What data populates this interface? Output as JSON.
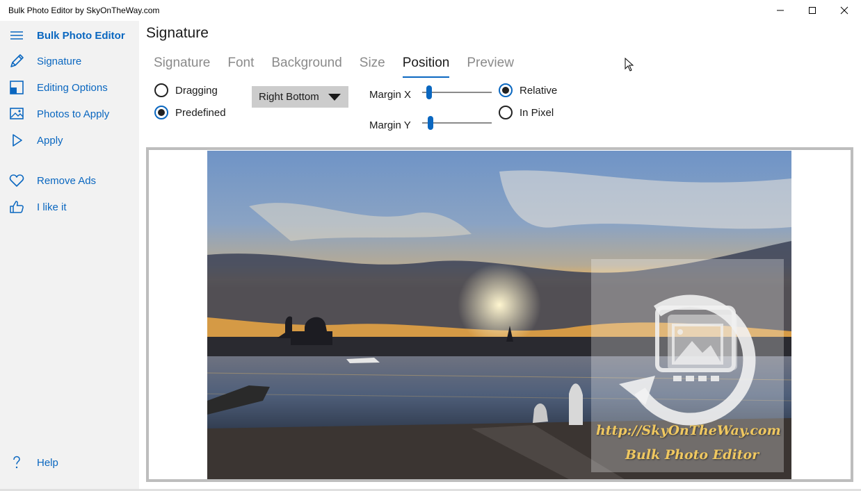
{
  "window": {
    "title": "Bulk Photo Editor by SkyOnTheWay.com",
    "controls": [
      "minimize-icon",
      "maximize-icon",
      "close-icon"
    ]
  },
  "sidebar": {
    "app_title": "Bulk Photo Editor",
    "items": [
      {
        "label": "Signature",
        "icon": "pencil-icon"
      },
      {
        "label": "Editing Options",
        "icon": "editing-options-icon"
      },
      {
        "label": "Photos to Apply",
        "icon": "image-icon"
      },
      {
        "label": "Apply",
        "icon": "play-icon"
      },
      {
        "label": "Remove Ads",
        "icon": "heart-icon"
      },
      {
        "label": "I like it",
        "icon": "thumbs-up-icon"
      },
      {
        "label": "Help",
        "icon": "question-icon"
      }
    ]
  },
  "main": {
    "title": "Signature",
    "tabs": [
      "Signature",
      "Font",
      "Background",
      "Size",
      "Position",
      "Preview"
    ],
    "active_tab": "Position",
    "position": {
      "mode_options": [
        {
          "label": "Dragging",
          "checked": false
        },
        {
          "label": "Predefined",
          "checked": true
        }
      ],
      "predefined_value": "Right Bottom",
      "margin_x_label": "Margin X",
      "margin_y_label": "Margin Y",
      "margin_x_value": 0.06,
      "margin_y_value": 0.09,
      "unit_options": [
        {
          "label": "Relative",
          "checked": true
        },
        {
          "label": "In Pixel",
          "checked": false
        }
      ]
    },
    "preview": {
      "watermark_line1": "http://SkyOnTheWay.com",
      "watermark_line2": "Bulk Photo Editor"
    }
  },
  "colors": {
    "accent": "#0a67c0",
    "sidebar_bg": "#f2f2f2",
    "dropdown_bg": "#cccccc",
    "watermark_text": "#f0c860"
  }
}
